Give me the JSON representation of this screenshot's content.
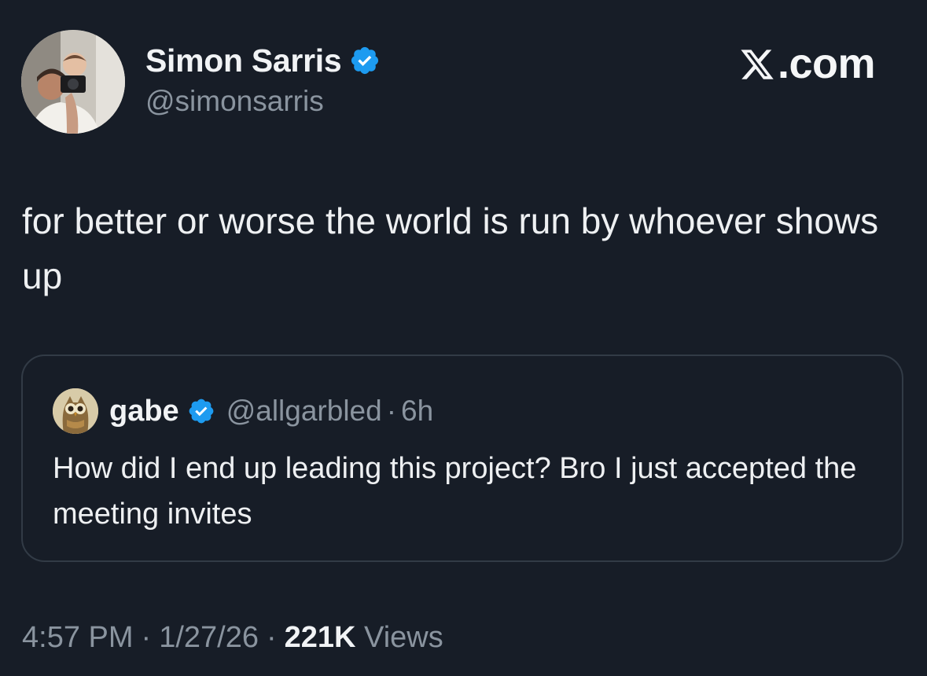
{
  "author": {
    "display_name": "Simon Sarris",
    "handle": "@simonsarris",
    "verified": true,
    "avatar_icon": "profile-photo-person-with-baby-and-camera"
  },
  "brand": {
    "label": ".com",
    "logo_icon": "x-logo-icon"
  },
  "tweet": {
    "text": "for better or worse the world is run by whoever shows up"
  },
  "quoted_tweet": {
    "display_name": "gabe",
    "handle": "@allgarbled",
    "separator": "·",
    "time_ago": "6h",
    "verified": true,
    "avatar_icon": "owl-avatar",
    "text": "How did I end up leading this project? Bro I just accepted the meeting invites"
  },
  "meta": {
    "time": "4:57 PM",
    "separator": "·",
    "date": "1/27/26",
    "views_count": "221K",
    "views_label": "Views"
  },
  "colors": {
    "background": "#171d27",
    "text_primary": "#eef0f2",
    "text_secondary": "#8a949f",
    "verified_blue": "#1d9bf0",
    "card_border": "#323b46"
  }
}
